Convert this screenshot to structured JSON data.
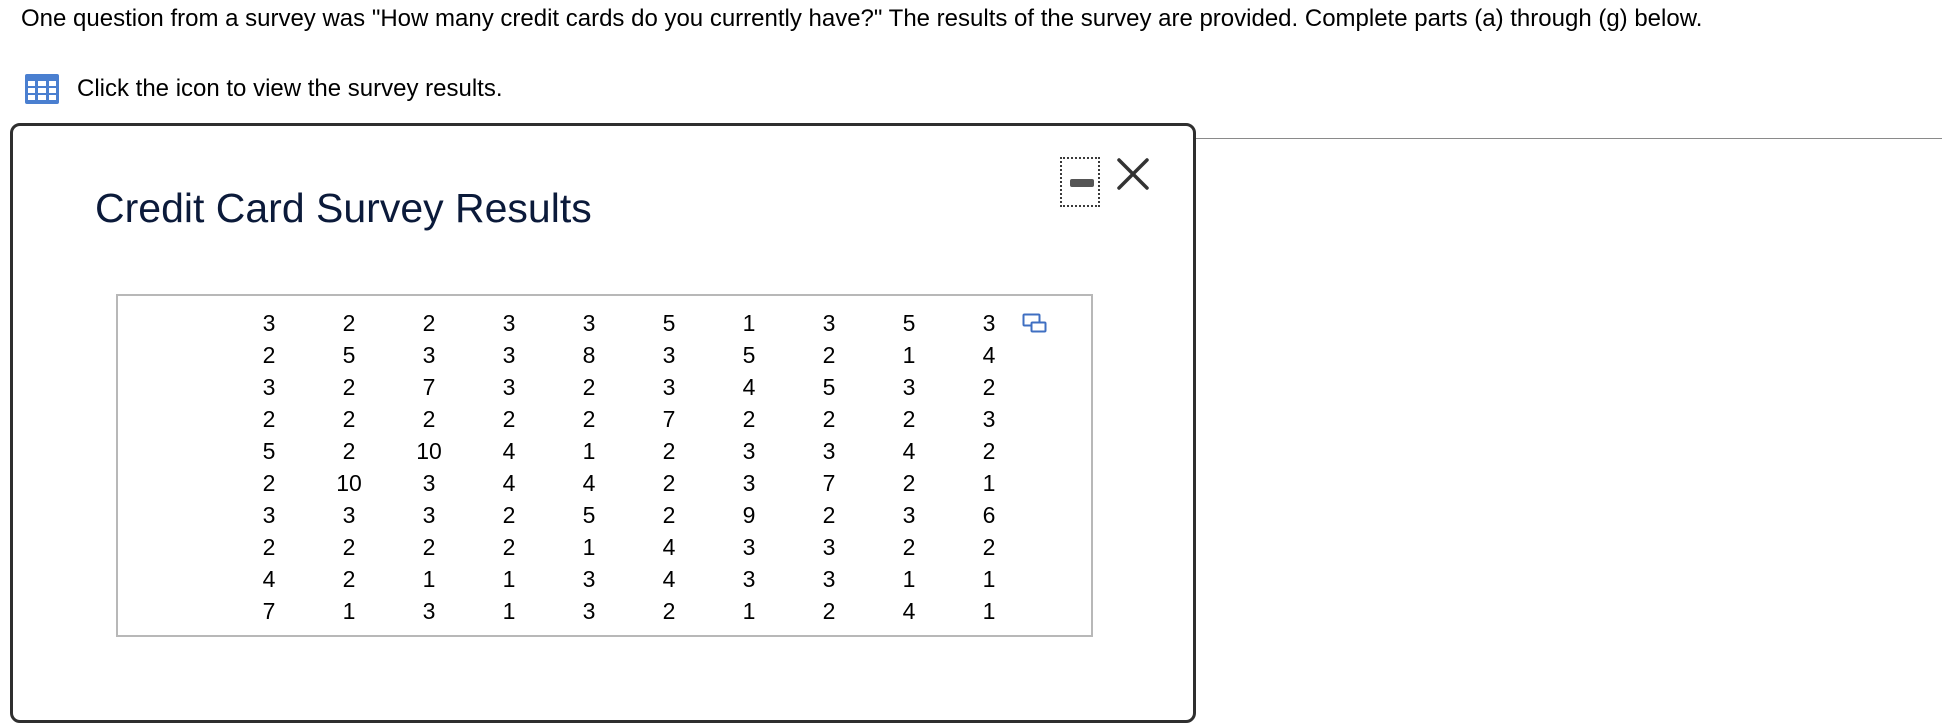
{
  "question": {
    "text": "One question from a survey was \"How many credit cards do you currently have?\" The results of the survey are provided. Complete parts (a) through (g) below."
  },
  "data_link": {
    "icon": "table-grid-icon",
    "label": "Click the icon to view the survey results."
  },
  "dialog": {
    "title": "Credit Card Survey Results",
    "minimize_icon": "minimize-icon",
    "close_icon": "close-icon",
    "copy_icon": "copy-data-icon",
    "table": {
      "rows": [
        [
          "3",
          "2",
          "2",
          "3",
          "3",
          "5",
          "1",
          "3",
          "5",
          "3"
        ],
        [
          "2",
          "5",
          "3",
          "3",
          "8",
          "3",
          "5",
          "2",
          "1",
          "4"
        ],
        [
          "3",
          "2",
          "7",
          "3",
          "2",
          "3",
          "4",
          "5",
          "3",
          "2"
        ],
        [
          "2",
          "2",
          "2",
          "2",
          "2",
          "7",
          "2",
          "2",
          "2",
          "3"
        ],
        [
          "5",
          "2",
          "10",
          "4",
          "1",
          "2",
          "3",
          "3",
          "4",
          "2"
        ],
        [
          "2",
          "10",
          "3",
          "4",
          "4",
          "2",
          "3",
          "7",
          "2",
          "1"
        ],
        [
          "3",
          "3",
          "3",
          "2",
          "5",
          "2",
          "9",
          "2",
          "3",
          "6"
        ],
        [
          "2",
          "2",
          "2",
          "2",
          "1",
          "4",
          "3",
          "3",
          "2",
          "2"
        ],
        [
          "4",
          "2",
          "1",
          "1",
          "3",
          "4",
          "3",
          "3",
          "1",
          "1"
        ],
        [
          "7",
          "1",
          "3",
          "1",
          "3",
          "2",
          "1",
          "2",
          "4",
          "1"
        ]
      ]
    }
  },
  "colors": {
    "title": "#0b1a3a",
    "icon_blue": "#4a7fd0",
    "dialog_border": "#2f2f2f",
    "table_border": "#b8b8b8"
  }
}
